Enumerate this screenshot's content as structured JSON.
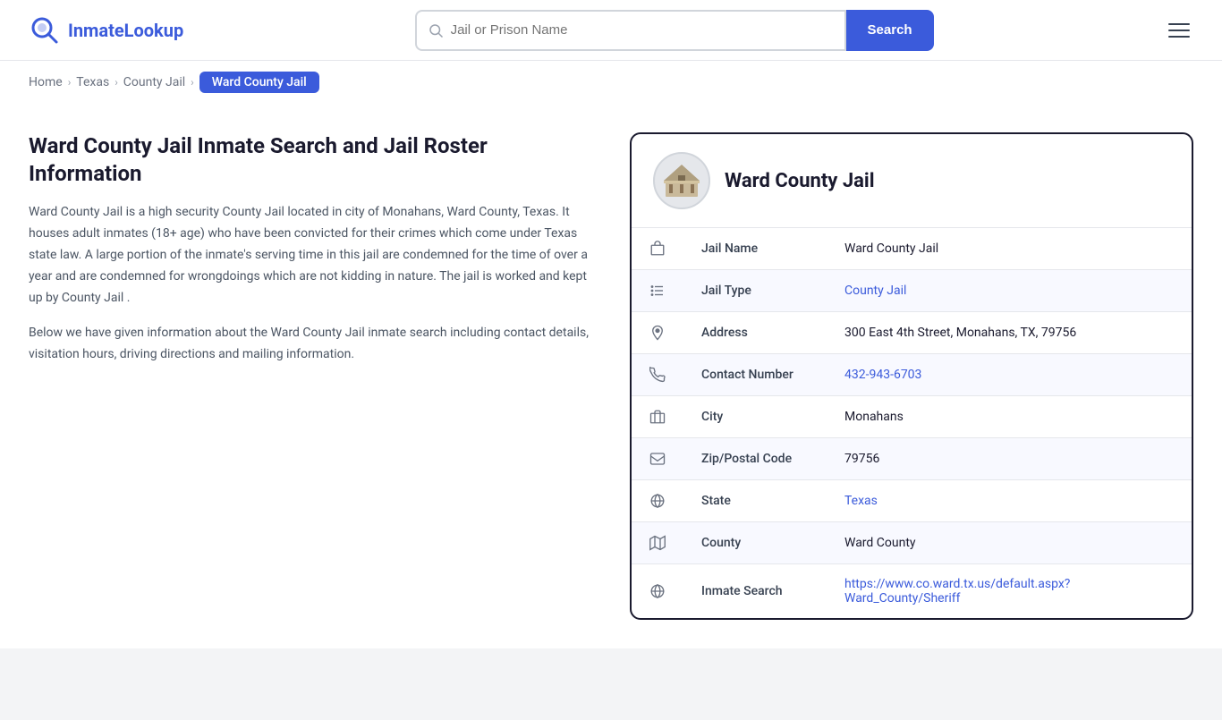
{
  "site": {
    "logo_text_plain": "Inmate",
    "logo_text_accent": "Lookup",
    "logo_icon": "search"
  },
  "header": {
    "search_placeholder": "Jail or Prison Name",
    "search_button_label": "Search"
  },
  "breadcrumb": {
    "home_label": "Home",
    "texas_label": "Texas",
    "county_jail_label": "County Jail",
    "current_label": "Ward County Jail"
  },
  "main": {
    "page_title": "Ward County Jail Inmate Search and Jail Roster Information",
    "description1": "Ward County Jail is a high security County Jail located in city of Monahans, Ward County, Texas. It houses adult inmates (18+ age) who have been convicted for their crimes which come under Texas state law. A large portion of the inmate's serving time in this jail are condemned for the time of over a year and are condemned for wrongdoings which are not kidding in nature. The jail is worked and kept up by County Jail .",
    "description2": "Below we have given information about the Ward County Jail inmate search including contact details, visitation hours, driving directions and mailing information."
  },
  "card": {
    "title": "Ward County Jail",
    "fields": [
      {
        "id": "jail-name",
        "icon": "building",
        "label": "Jail Name",
        "value": "Ward County Jail",
        "link": null
      },
      {
        "id": "jail-type",
        "icon": "list",
        "label": "Jail Type",
        "value": "County Jail",
        "link": "#"
      },
      {
        "id": "address",
        "icon": "location",
        "label": "Address",
        "value": "300 East 4th Street, Monahans, TX, 79756",
        "link": null
      },
      {
        "id": "contact",
        "icon": "phone",
        "label": "Contact Number",
        "value": "432-943-6703",
        "link": "tel:432-943-6703"
      },
      {
        "id": "city",
        "icon": "building2",
        "label": "City",
        "value": "Monahans",
        "link": null
      },
      {
        "id": "zip",
        "icon": "mail",
        "label": "Zip/Postal Code",
        "value": "79756",
        "link": null
      },
      {
        "id": "state",
        "icon": "globe",
        "label": "State",
        "value": "Texas",
        "link": "#"
      },
      {
        "id": "county",
        "icon": "map",
        "label": "County",
        "value": "Ward County",
        "link": null
      },
      {
        "id": "inmate-search",
        "icon": "search-globe",
        "label": "Inmate Search",
        "value": "https://www.co.ward.tx.us/default.aspx?Ward_County/Sheriff",
        "link": "https://www.co.ward.tx.us/default.aspx?Ward_County/Sheriff"
      }
    ]
  },
  "colors": {
    "accent": "#3b5bdb",
    "dark": "#1a1a2e"
  }
}
